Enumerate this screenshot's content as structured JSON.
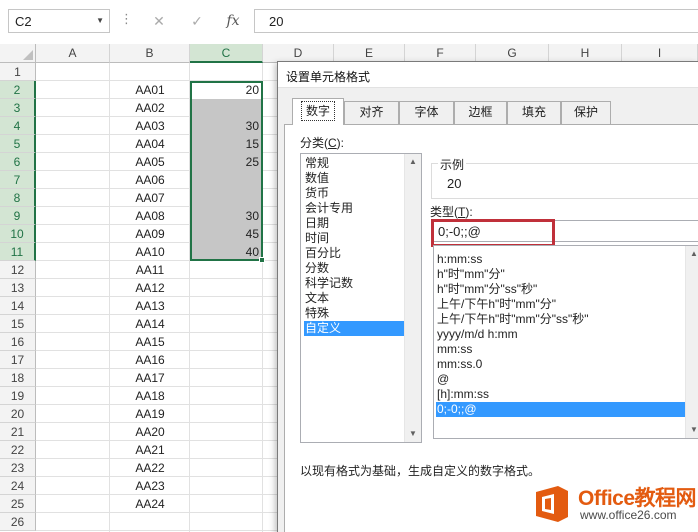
{
  "formula_bar": {
    "name_box": "C2",
    "cancel_icon": "✕",
    "confirm_icon": "✓",
    "fx_label": "fx",
    "formula_value": "20"
  },
  "grid": {
    "columns": [
      "A",
      "B",
      "C",
      "D",
      "E",
      "F",
      "G",
      "H",
      "I"
    ],
    "rows": [
      "1",
      "2",
      "3",
      "4",
      "5",
      "6",
      "7",
      "8",
      "9",
      "10",
      "11",
      "12",
      "13",
      "14",
      "15",
      "16",
      "17",
      "18",
      "19",
      "20",
      "21",
      "22",
      "23",
      "24",
      "25",
      "26"
    ],
    "column_b": [
      "",
      "AA01",
      "AA02",
      "AA03",
      "AA04",
      "AA05",
      "AA06",
      "AA07",
      "AA08",
      "AA09",
      "AA10",
      "AA11",
      "AA12",
      "AA13",
      "AA14",
      "AA15",
      "AA16",
      "AA17",
      "AA18",
      "AA19",
      "AA20",
      "AA21",
      "AA22",
      "AA23",
      "AA24",
      ""
    ],
    "column_c": [
      "",
      "20",
      "",
      "30",
      "15",
      "25",
      "",
      "",
      "30",
      "45",
      "40",
      "",
      "",
      "",
      "",
      "",
      "",
      "",
      "",
      "",
      "",
      "",
      "",
      "",
      "",
      ""
    ],
    "selected_column": "C",
    "selected_range": "C2:C11"
  },
  "dialog": {
    "title": "设置单元格格式",
    "tabs": [
      "数字",
      "对齐",
      "字体",
      "边框",
      "填充",
      "保护"
    ],
    "active_tab": "数字",
    "category_label": "分类(C):",
    "category_label_key": "C",
    "categories": [
      "常规",
      "数值",
      "货币",
      "会计专用",
      "日期",
      "时间",
      "百分比",
      "分数",
      "科学记数",
      "文本",
      "特殊",
      "自定义"
    ],
    "selected_category": "自定义",
    "sample_label": "示例",
    "sample_value": "20",
    "type_label": "类型(T):",
    "type_label_key": "T",
    "type_value": "0;-0;;@",
    "format_list": [
      "h:mm:ss",
      "h\"时\"mm\"分\"",
      "h\"时\"mm\"分\"ss\"秒\"",
      "上午/下午h\"时\"mm\"分\"",
      "上午/下午h\"时\"mm\"分\"ss\"秒\"",
      "yyyy/m/d h:mm",
      "mm:ss",
      "mm:ss.0",
      "@",
      "[h]:mm:ss",
      "0;-0;;@"
    ],
    "selected_format": "0;-0;;@",
    "description": "以现有格式为基础，生成自定义的数字格式。"
  },
  "logo": {
    "brand": "Office教程网",
    "url": "www.office26.com"
  },
  "colors": {
    "excel_green": "#217346",
    "selection_blue": "#3399ff",
    "highlight_red": "#c0303a",
    "logo_orange": "#e35b10"
  }
}
